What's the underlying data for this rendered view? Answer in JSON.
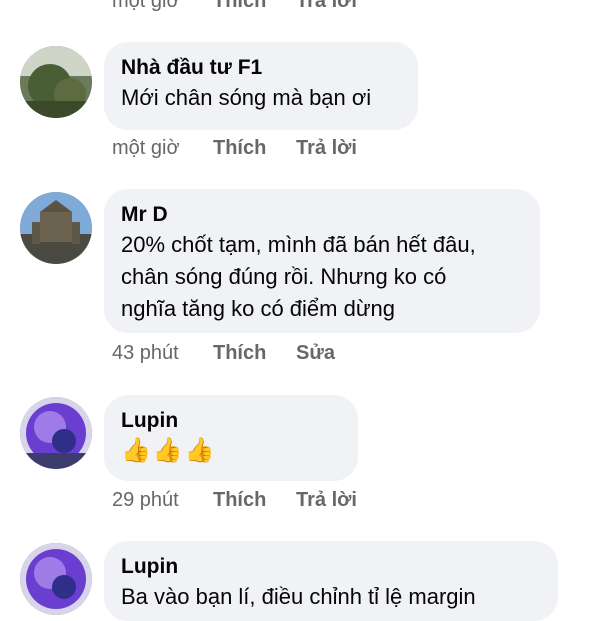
{
  "top_actions": {
    "time": "một giờ",
    "like": "Thích",
    "reply": "Trả lời"
  },
  "comments": [
    {
      "author": "Nhà đầu tư F1",
      "text": "Mới chân sóng mà bạn ơi",
      "time": "một giờ",
      "like": "Thích",
      "action": "Trả lời"
    },
    {
      "author": "Mr D",
      "text_lines": [
        "20% chốt tạm, mình đã bán hết đâu,",
        "chân sóng đúng rồi. Nhưng ko có",
        "nghĩa tăng ko có điểm dừng"
      ],
      "time": "43 phút",
      "like": "Thích",
      "action": "Sửa"
    },
    {
      "author": "Lupin",
      "text": "👍👍👍",
      "time": "29 phút",
      "like": "Thích",
      "action": "Trả lời"
    },
    {
      "author": "Lupin",
      "text": "Ba vào bạn lí, điều chỉnh tỉ lệ margin"
    }
  ]
}
